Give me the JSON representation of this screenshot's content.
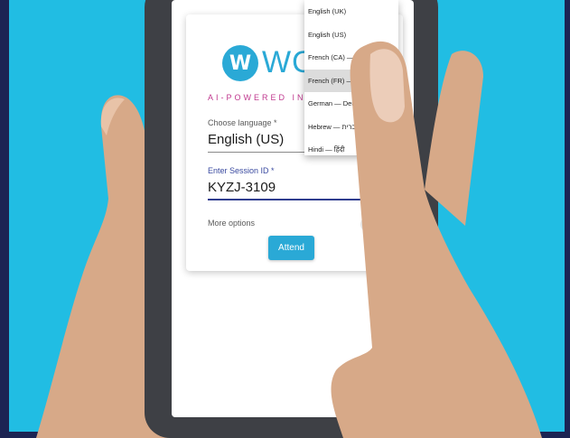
{
  "app": {
    "logo_letter": "W",
    "logo_text": "WORDLY",
    "tagline": "AI-POWERED INTERPRETATION"
  },
  "language_field": {
    "label": "Choose language *",
    "value": "English (US)"
  },
  "session_field": {
    "label": "Enter Session ID *",
    "value": "KYZJ-3109"
  },
  "more_options_label": "More options",
  "help_label": "?",
  "attend_label": "Attend",
  "language_dropdown": {
    "items": [
      {
        "label": "English (UK)",
        "selected": false
      },
      {
        "label": "English (US)",
        "selected": false
      },
      {
        "label": "French (CA) — Français",
        "selected": false
      },
      {
        "label": "French (FR) — Français",
        "selected": true
      },
      {
        "label": "German — Deutsch",
        "selected": false
      },
      {
        "label": "Hebrew — עברית",
        "selected": false
      },
      {
        "label": "Hindi — हिंदी",
        "selected": false
      }
    ]
  },
  "colors": {
    "background_blue": "#21bde3",
    "brand_blue": "#2aa9d6",
    "tagline_magenta": "#c0398f",
    "frame_navy": "#1c2453"
  }
}
